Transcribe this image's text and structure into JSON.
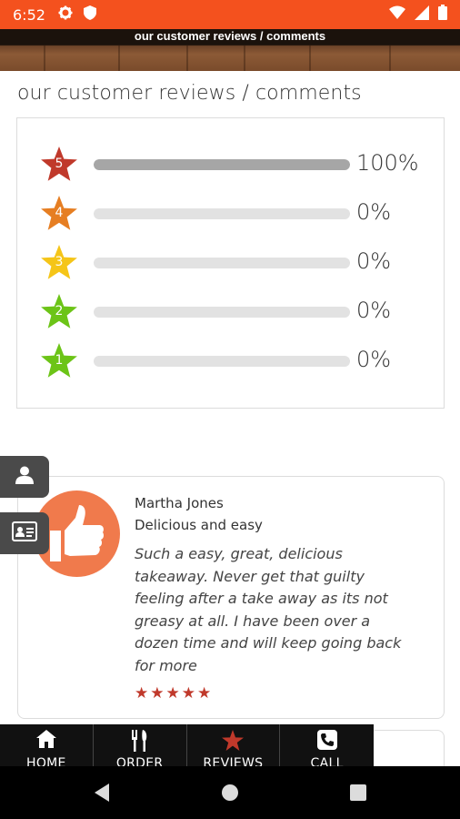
{
  "status_bar": {
    "time": "6:52",
    "left_icons": [
      "gear-icon",
      "shield-icon"
    ],
    "right_icons": [
      "wifi-icon",
      "signal-icon",
      "battery-icon"
    ],
    "color": "#f4511e"
  },
  "header": {
    "banner_title": "our customer reviews / comments"
  },
  "page": {
    "title": "our customer reviews / comments"
  },
  "ratings": {
    "rows": [
      {
        "star": "5",
        "percent": "100%",
        "fill": 1.0,
        "color": "#c0392b"
      },
      {
        "star": "4",
        "percent": "0%",
        "fill": 0.0,
        "color": "#e67e22"
      },
      {
        "star": "3",
        "percent": "0%",
        "fill": 0.0,
        "color": "#f5c518"
      },
      {
        "star": "2",
        "percent": "0%",
        "fill": 0.0,
        "color": "#6cc417"
      },
      {
        "star": "1",
        "percent": "0%",
        "fill": 0.0,
        "color": "#6cc417"
      }
    ]
  },
  "review": {
    "name": "Martha Jones",
    "title": "Delicious and easy",
    "text": "Such a easy, great, delicious takeaway. Never get that guilty feeling after a take away as its not greasy at all. I have been over a dozen time and will keep going back for more",
    "stars": "★★★★★",
    "rating": 5,
    "accent": "#f07a4c"
  },
  "side_buttons": [
    "user-icon",
    "contact-card-icon"
  ],
  "bottom_nav": [
    {
      "label": "HOME",
      "icon": "home-icon"
    },
    {
      "label": "ORDER",
      "icon": "utensils-icon"
    },
    {
      "label": "REVIEWS",
      "icon": "star-icon"
    },
    {
      "label": "CALL",
      "icon": "phone-icon"
    }
  ],
  "android_nav": [
    "back-icon",
    "home-circle-icon",
    "recents-icon"
  ]
}
